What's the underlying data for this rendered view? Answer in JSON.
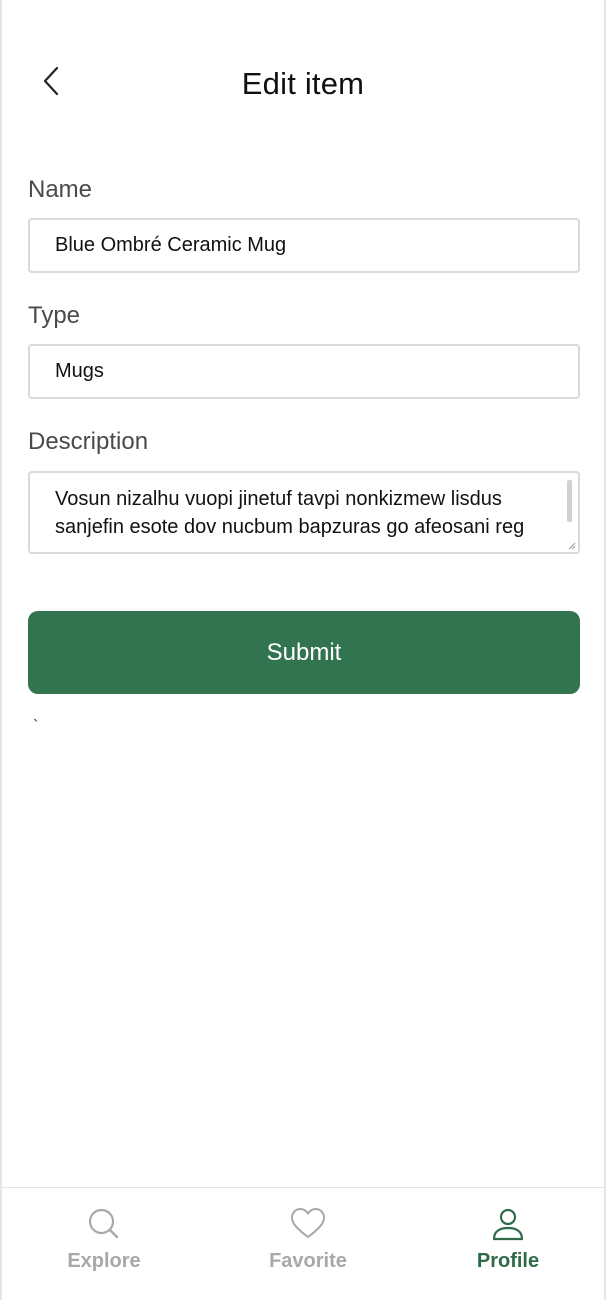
{
  "header": {
    "title": "Edit item",
    "back_icon": "chevron-left-icon"
  },
  "form": {
    "name_label": "Name",
    "name_value": "Blue Ombré Ceramic Mug",
    "type_label": "Type",
    "type_value": "Mugs",
    "description_label": "Description",
    "description_value": "Vosun nizalhu vuopi jinetuf tavpi nonkizmew lisdus sanjefin esote dov nucbum bapzuras go afeosani reg",
    "submit_label": "Submit"
  },
  "stray_mark": "`",
  "tabbar": {
    "tabs": [
      {
        "label": "Explore",
        "icon": "search-icon",
        "active": false
      },
      {
        "label": "Favorite",
        "icon": "heart-icon",
        "active": false
      },
      {
        "label": "Profile",
        "icon": "user-icon",
        "active": true
      }
    ]
  },
  "colors": {
    "accent": "#337450",
    "inactive_tab": "#a8a8a8",
    "active_tab": "#2f6b49",
    "label": "#4a4a4a",
    "border": "#d9d9d9"
  }
}
